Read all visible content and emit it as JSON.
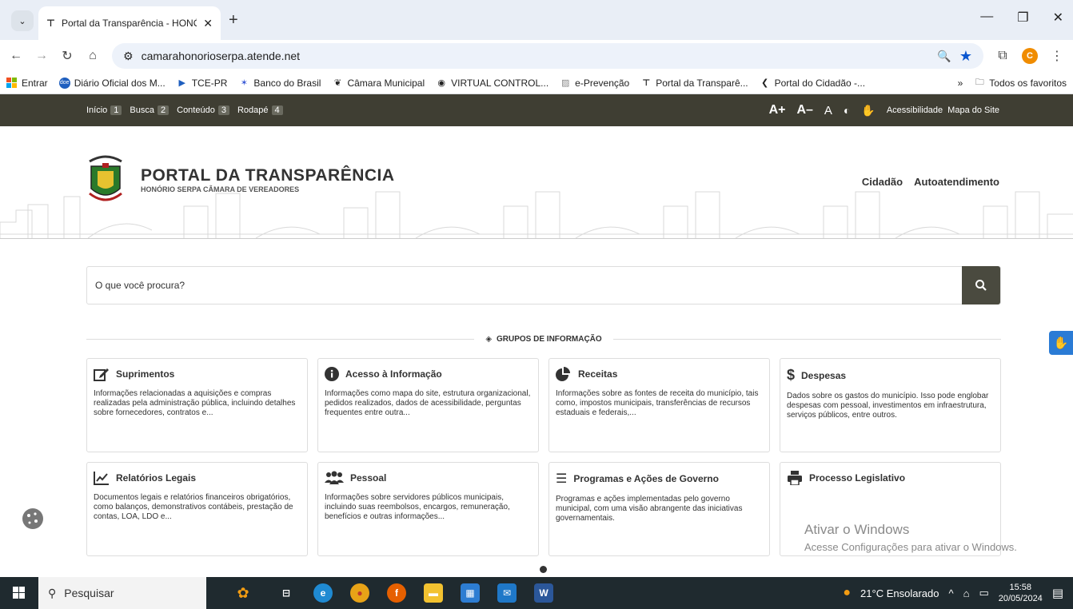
{
  "browser": {
    "tab_title": "Portal da Transparência - HONÓRIO SERPA",
    "url": "camarahonorioserpa.atende.net",
    "avatar_letter": "C",
    "bookmarks": [
      "Entrar",
      "Diário Oficial dos M...",
      "TCE-PR",
      "Banco do Brasil",
      "Câmara Municipal",
      "VIRTUAL CONTROL...",
      "e-Prevenção",
      "Portal da Transparê...",
      "Portal do Cidadão -..."
    ],
    "more": "»",
    "all_bookmarks": "Todos os favoritos"
  },
  "topnav": {
    "skip": [
      {
        "label": "Início",
        "n": "1"
      },
      {
        "label": "Busca",
        "n": "2"
      },
      {
        "label": "Conteúdo",
        "n": "3"
      },
      {
        "label": "Rodapé",
        "n": "4"
      }
    ],
    "font_plus": "A+",
    "font_minus": "A–",
    "font_reset": "A",
    "accessibility": "Acessibilidade",
    "sitemap": "Mapa do Site"
  },
  "header": {
    "title": "PORTAL DA TRANSPARÊNCIA",
    "subtitle": "HONÓRIO SERPA CÂMARA DE VEREADORES",
    "link1": "Cidadão",
    "link2": "Autoatendimento"
  },
  "search": {
    "placeholder": "O que você procura?"
  },
  "section_title": "GRUPOS DE INFORMAÇÃO",
  "cards": [
    {
      "title": "Suprimentos",
      "desc": "Informações relacionadas a aquisições e compras realizadas pela administração pública, incluindo detalhes sobre fornecedores, contratos e...",
      "icon": "edit-icon"
    },
    {
      "title": "Acesso à Informação",
      "desc": "Informações como mapa do site, estrutura organizacional, pedidos realizados, dados de acessibilidade, perguntas frequentes entre outra...",
      "icon": "info-icon"
    },
    {
      "title": "Receitas",
      "desc": "Informações sobre as fontes de receita do município, tais como, impostos municipais, transferências de recursos estaduais e federais,...",
      "icon": "pie-chart-icon"
    },
    {
      "title": "Despesas",
      "desc": "Dados sobre os gastos do município. Isso pode englobar despesas com pessoal, investimentos em infraestrutura, serviços públicos, entre outros.",
      "icon": "dollar-icon"
    },
    {
      "title": "Relatórios Legais",
      "desc": "Documentos legais e relatórios financeiros obrigatórios, como balanços, demonstrativos contábeis, prestação de contas, LOA, LDO e...",
      "icon": "line-chart-icon"
    },
    {
      "title": "Pessoal",
      "desc": "Informações sobre servidores públicos municipais, incluindo suas reembolsos, encargos, remuneração, benefícios e outras informações...",
      "icon": "users-icon"
    },
    {
      "title": "Programas e Ações de Governo",
      "desc": "Programas e ações implementadas pelo governo municipal, com uma visão abrangente das iniciativas governamentais.",
      "icon": "checklist-icon"
    },
    {
      "title": "Processo Legislativo",
      "desc": "",
      "icon": "print-icon"
    }
  ],
  "watermark": {
    "line1": "Ativar o Windows",
    "line2": "Acesse Configurações para ativar o Windows."
  },
  "taskbar": {
    "search": "Pesquisar",
    "weather": "21°C  Ensolarado",
    "time": "15:58",
    "date": "20/05/2024"
  }
}
